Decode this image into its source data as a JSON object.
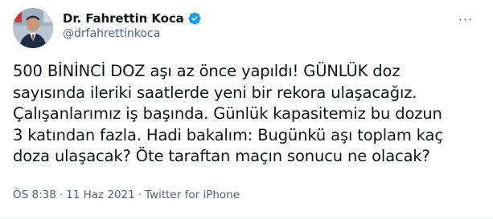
{
  "author": {
    "display_name": "Dr. Fahrettin Koca",
    "handle": "@drfahrettinkoca",
    "verified_icon": "verified-badge-icon",
    "verified_color": "#1d9bf0"
  },
  "tweet": {
    "text": "500 BİNİNCİ DOZ aşı az önce yapıldı! GÜNLÜK doz\nsayısında ileriki saatlerde yeni bir rekora ulaşacağız.\nÇalışanlarımız iş başında. Günlük kapasitemiz bu dozun\n3 katından fazla. Hadi bakalım: Bugünkü aşı toplam kaç\ndoza ulaşacak? Öte taraftan maçın sonucu ne olacak?"
  },
  "meta": {
    "time": "ÖS 8:38",
    "separator_1": "·",
    "date": "11 Haz 2021",
    "separator_2": "·",
    "source": "Twitter for iPhone"
  },
  "more_button": {
    "label": "···",
    "icon": "more-options-icon"
  }
}
